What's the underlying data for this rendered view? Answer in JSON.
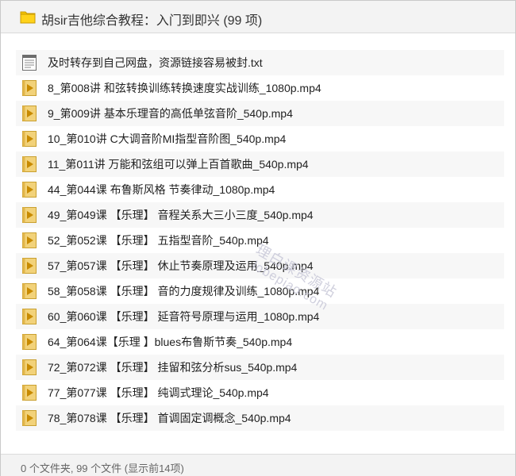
{
  "header": {
    "title": "胡sir吉他综合教程：入门到即兴 (99 项)",
    "folder_icon": "folder-icon"
  },
  "files": [
    {
      "name": "及时转存到自己网盘，资源链接容易被封.txt",
      "type": "txt",
      "icon": "text-file-icon"
    },
    {
      "name": "8_第008讲 和弦转换训练转换速度实战训练_1080p.mp4",
      "type": "video",
      "icon": "video-file-icon"
    },
    {
      "name": "9_第009讲 基本乐理音的高低单弦音阶_540p.mp4",
      "type": "video",
      "icon": "video-file-icon"
    },
    {
      "name": "10_第010讲 C大调音阶MI指型音阶图_540p.mp4",
      "type": "video",
      "icon": "video-file-icon"
    },
    {
      "name": "11_第011讲 万能和弦组可以弹上百首歌曲_540p.mp4",
      "type": "video",
      "icon": "video-file-icon"
    },
    {
      "name": "44_第044课 布鲁斯风格 节奏律动_1080p.mp4",
      "type": "video",
      "icon": "video-file-icon"
    },
    {
      "name": "49_第049课 【乐理】 音程关系大三小三度_540p.mp4",
      "type": "video",
      "icon": "video-file-icon"
    },
    {
      "name": "52_第052课 【乐理】 五指型音阶_540p.mp4",
      "type": "video",
      "icon": "video-file-icon"
    },
    {
      "name": "57_第057课 【乐理】 休止节奏原理及运用_540p.mp4",
      "type": "video",
      "icon": "video-file-icon"
    },
    {
      "name": "58_第058课 【乐理】 音的力度规律及训练_1080p.mp4",
      "type": "video",
      "icon": "video-file-icon"
    },
    {
      "name": "60_第060课 【乐理】 延音符号原理与运用_1080p.mp4",
      "type": "video",
      "icon": "video-file-icon"
    },
    {
      "name": "64_第064课【乐理 】blues布鲁斯节奏_540p.mp4",
      "type": "video",
      "icon": "video-file-icon"
    },
    {
      "name": "72_第072课 【乐理】 挂留和弦分析sus_540p.mp4",
      "type": "video",
      "icon": "video-file-icon"
    },
    {
      "name": "77_第077课 【乐理】 纯调式理论_540p.mp4",
      "type": "video",
      "icon": "video-file-icon"
    },
    {
      "name": "78_第078课 【乐理】 首调固定调概念_540p.mp4",
      "type": "video",
      "icon": "video-file-icon"
    }
  ],
  "footer": {
    "status": "0 个文件夹, 99 个文件 (显示前14项)"
  },
  "watermark": {
    "line1": "理白课资源站",
    "line2": "lobepiao.com"
  },
  "colors": {
    "folder": "#f5c400",
    "video_icon_bg": "#f2d27a",
    "video_play": "#c88a00",
    "header_bg": "#f3f3f3"
  }
}
